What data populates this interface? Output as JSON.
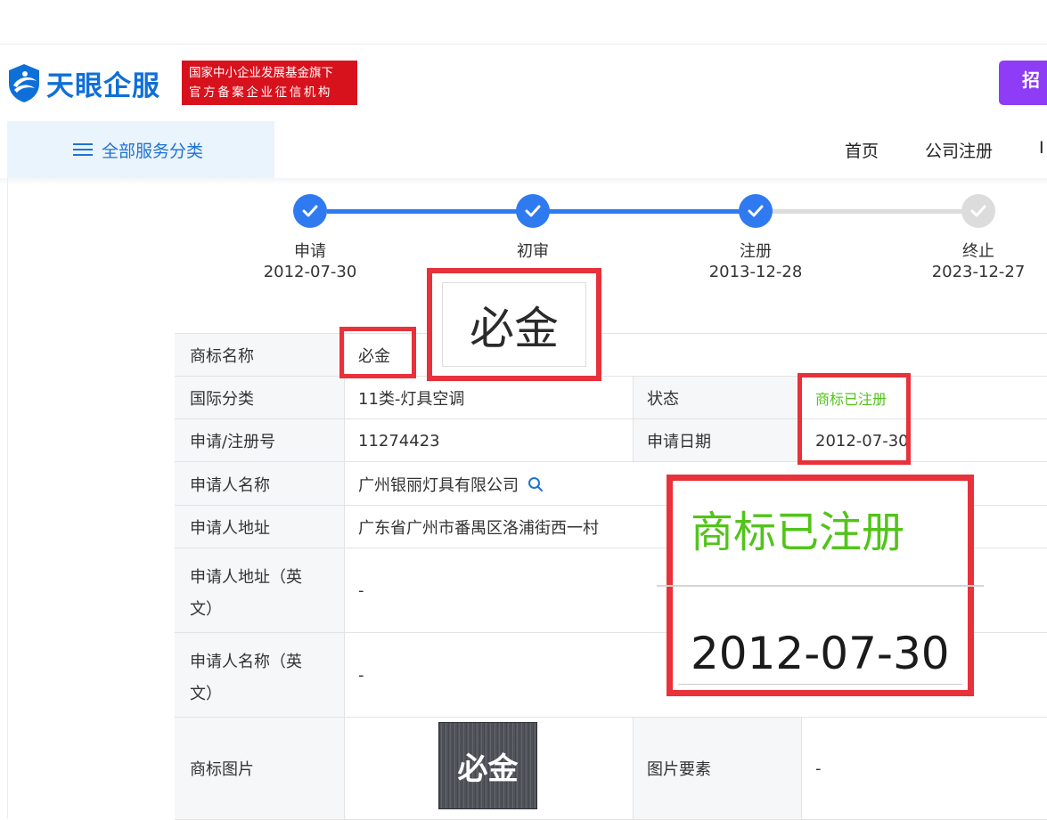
{
  "header": {
    "brand": "天眼企服",
    "badge_line1": "国家中小企业发展基金旗下",
    "badge_line2": "官方备案企业征信机构",
    "cta_partial": "招"
  },
  "menu": {
    "label": "全部服务分类"
  },
  "nav": {
    "items": [
      "首页",
      "公司注册",
      "Ⅰ"
    ]
  },
  "progress": {
    "steps": [
      {
        "name": "申请",
        "date": "2012-07-30",
        "done": true
      },
      {
        "name": "初审",
        "date": "",
        "done": true
      },
      {
        "name": "注册",
        "date": "2013-12-28",
        "done": true
      },
      {
        "name": "终止",
        "date": "2023-12-27",
        "done": false
      }
    ],
    "colors": {
      "done": "#2f7af0",
      "todo": "#dcdcdc"
    }
  },
  "table": {
    "trademark_name_label": "商标名称",
    "trademark_name": "必金",
    "intl_class_label": "国际分类",
    "intl_class": "11类-灯具空调",
    "status_label": "状态",
    "status": "商标已注册",
    "reg_no_label": "申请/注册号",
    "reg_no": "11274423",
    "apply_date_label": "申请日期",
    "apply_date": "2012-07-30",
    "applicant_label": "申请人名称",
    "applicant": "广州银丽灯具有限公司",
    "address_label": "申请人地址",
    "address": "广东省广州市番禺区洛浦街西一村",
    "address_en_label_1": "申请人地址（英",
    "address_en_label_2": "文）",
    "address_en": "-",
    "name_en_label_1": "申请人名称（英",
    "name_en_label_2": "文）",
    "name_en": "-",
    "image_label": "商标图片",
    "image_text": "必金",
    "image_elements_label": "图片要素",
    "image_elements": "-"
  },
  "zoom": {
    "name": "必金",
    "status": "商标已注册",
    "date": "2012-07-30"
  },
  "colors": {
    "brand": "#0f6fd8",
    "badge": "#d8121d",
    "status_green": "#52c41a",
    "highlight_red": "#e8313a",
    "cta_purple": "#8e3cf5"
  }
}
